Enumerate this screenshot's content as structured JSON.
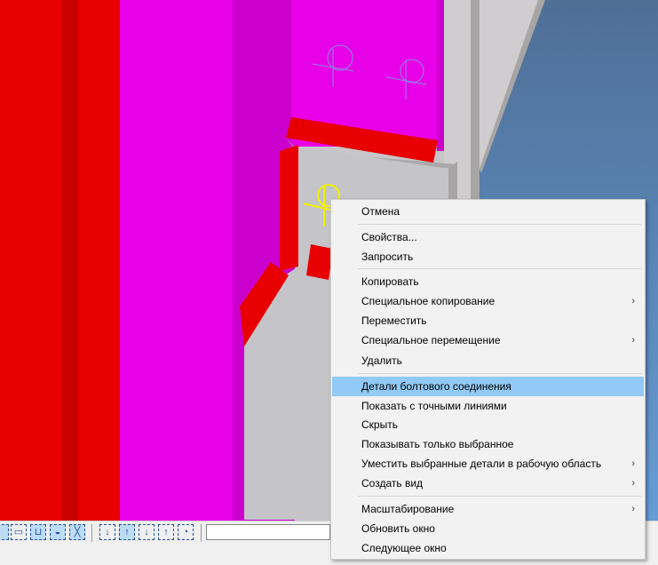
{
  "context_menu": {
    "items": [
      {
        "label": "Отмена",
        "submenu": false
      },
      {
        "label": "Свойства...",
        "submenu": false
      },
      {
        "label": "Запросить",
        "submenu": false
      },
      {
        "label": "Копировать",
        "submenu": false
      },
      {
        "label": "Специальное копирование",
        "submenu": true
      },
      {
        "label": "Переместить",
        "submenu": false
      },
      {
        "label": "Специальное перемещение",
        "submenu": true
      },
      {
        "label": "Удалить",
        "submenu": false
      },
      {
        "label": "Детали болтового соединения",
        "submenu": false,
        "highlighted": true
      },
      {
        "label": "Показать с точными линиями",
        "submenu": false
      },
      {
        "label": "Скрыть",
        "submenu": false
      },
      {
        "label": "Показывать только выбранное",
        "submenu": false
      },
      {
        "label": "Уместить выбранные детали в рабочую область",
        "submenu": true
      },
      {
        "label": "Создать вид",
        "submenu": true
      },
      {
        "label": "Масштабирование",
        "submenu": true
      },
      {
        "label": "Обновить окно",
        "submenu": false
      },
      {
        "label": "Следующее окно",
        "submenu": false
      }
    ],
    "submenu_arrow": "›"
  },
  "toolbar": {
    "input_value": ""
  },
  "colors": {
    "highlight": "#91c9f7",
    "red": "#e80000",
    "magenta": "#e800e8",
    "sky": "#5a8cc0"
  }
}
